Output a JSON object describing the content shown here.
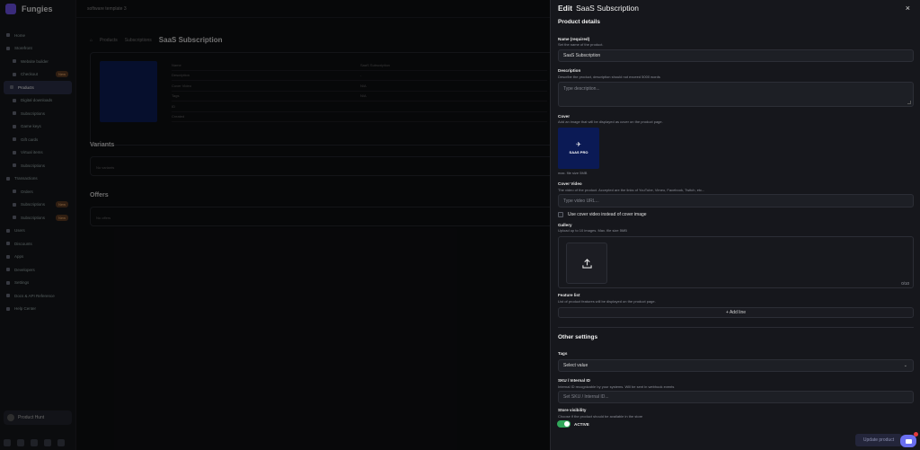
{
  "brand": {
    "name": "Fungies"
  },
  "topbar": {
    "workspace": "software template 3"
  },
  "sidebar": {
    "items": [
      {
        "label": "Home"
      },
      {
        "label": "Storefront"
      },
      {
        "label": "Website builder",
        "sub": true
      },
      {
        "label": "Checkout",
        "sub": true,
        "badge": "New"
      },
      {
        "label": "Products",
        "active": true
      },
      {
        "label": "Digital downloads",
        "sub": true
      },
      {
        "label": "Subscriptions",
        "sub": true
      },
      {
        "label": "Game keys",
        "sub": true
      },
      {
        "label": "Gift cards",
        "sub": true
      },
      {
        "label": "Virtual items",
        "sub": true
      },
      {
        "label": "Subscriptions",
        "sub": true
      },
      {
        "label": "Transactions"
      },
      {
        "label": "Orders",
        "sub": true
      },
      {
        "label": "Subscriptions",
        "sub": true,
        "badge": "New"
      },
      {
        "label": "Subscriptions",
        "sub": true,
        "badge": "New"
      },
      {
        "label": "Users"
      },
      {
        "label": "Discounts"
      },
      {
        "label": "Apps"
      },
      {
        "label": "Developers"
      },
      {
        "label": "Settings"
      },
      {
        "label": "Docs & API Reference"
      },
      {
        "label": "Help Center"
      }
    ],
    "account": "Product Hunt",
    "footer_label": "Connect with us"
  },
  "background_page": {
    "breadcrumb": [
      "Products",
      "Subscriptions"
    ],
    "title": "SaaS Subscription",
    "rows": [
      {
        "k": "Name",
        "v": "SaaS Subscription"
      },
      {
        "k": "Description",
        "v": "-"
      },
      {
        "k": "Cover Video",
        "v": "N/A"
      },
      {
        "k": "Tags",
        "v": "N/A"
      },
      {
        "k": "ID",
        "v": ""
      },
      {
        "k": "Created",
        "v": ""
      }
    ],
    "variants_title": "Variants",
    "variants_empty": "No variants",
    "offers_title": "Offers",
    "offers_empty": "No offers"
  },
  "drawer": {
    "title_prefix": "Edit",
    "title_name": "SaaS Subscription",
    "close": "×",
    "product_details": "Product details",
    "name_label": "Name (required)",
    "name_help": "Set the name of the product.",
    "name_value": "SaaS Subscription",
    "description_label": "Description",
    "description_help": "Describe the product, description should not exceed 5000 words",
    "description_placeholder": "Type description...",
    "cover_label": "Cover",
    "cover_help": "Add an image that will be displayed as cover on the product page.",
    "cover_caption": "SAAS PRO",
    "cover_max": "max. file size 5MB",
    "cover_video_label": "Cover Video",
    "cover_video_help": "The video of the product. Accepted are the links of YouTube, Vimeo, Facebook, Twitch, etc...",
    "cover_video_placeholder": "Type video URL...",
    "use_cover_video": "Use cover video instead of cover image",
    "gallery_label": "Gallery",
    "gallery_help": "Upload up to 10 images. Max. file size 5MB",
    "gallery_count": "0/10",
    "feature_label": "Feature list",
    "feature_help": "List of product features will be displayed on the product page.",
    "add_line": "+ Add line",
    "other_settings": "Other settings",
    "tags_label": "Tags",
    "tags_value": "Select value",
    "sku_label": "SKU / Internal ID",
    "sku_help": "Internal ID recognizable by your systems. Will be sent in webhook events",
    "sku_placeholder": "Set SKU / Internal ID...",
    "visibility_label": "Store visibility",
    "visibility_help": "Choose if the product should be available in the store",
    "visibility_state": "ACTIVE",
    "update_button": "Update product"
  },
  "colors": {
    "accent": "#6a6ff0",
    "toggle_on": "#31a75a",
    "cover_bg": "#0b1a55"
  }
}
